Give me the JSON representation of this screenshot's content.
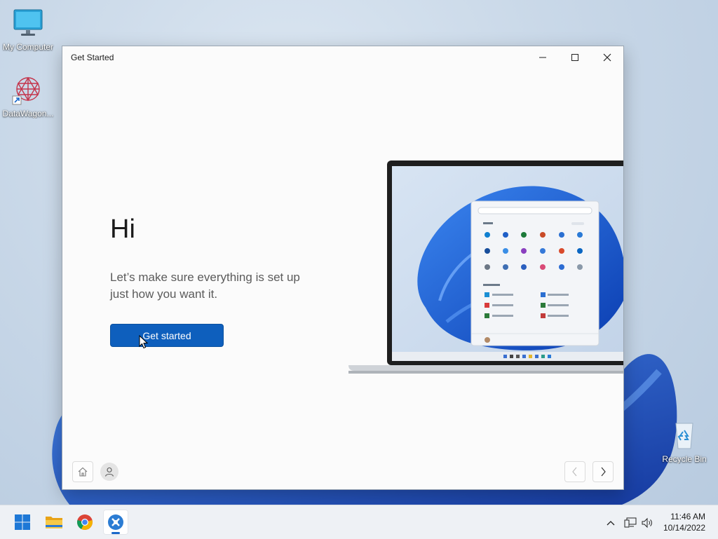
{
  "desktop": {
    "icons": [
      {
        "label": "My Computer"
      },
      {
        "label": "DataWagon..."
      },
      {
        "label": "Recycle Bin"
      }
    ]
  },
  "window": {
    "title": "Get Started",
    "heading": "Hi",
    "subtitle": "Let’s make sure everything is set up just how you want it.",
    "cta_label": "Get started",
    "footer": {
      "home_icon": "home-icon",
      "account_icon": "person-icon",
      "back_icon": "chevron-left-icon",
      "next_icon": "chevron-right-icon"
    }
  },
  "taskbar": {
    "apps": [
      {
        "name": "start",
        "icon": "windows-logo-icon"
      },
      {
        "name": "file-explorer",
        "icon": "folder-icon"
      },
      {
        "name": "chrome",
        "icon": "chrome-icon"
      },
      {
        "name": "get-started",
        "icon": "get-started-icon",
        "active": true
      }
    ],
    "clock": {
      "time": "11:46 AM",
      "date": "10/14/2022"
    }
  },
  "colors": {
    "accent": "#0e5fbd",
    "taskbar": "#eef1f5",
    "window_bg": "#fbfbfb"
  }
}
